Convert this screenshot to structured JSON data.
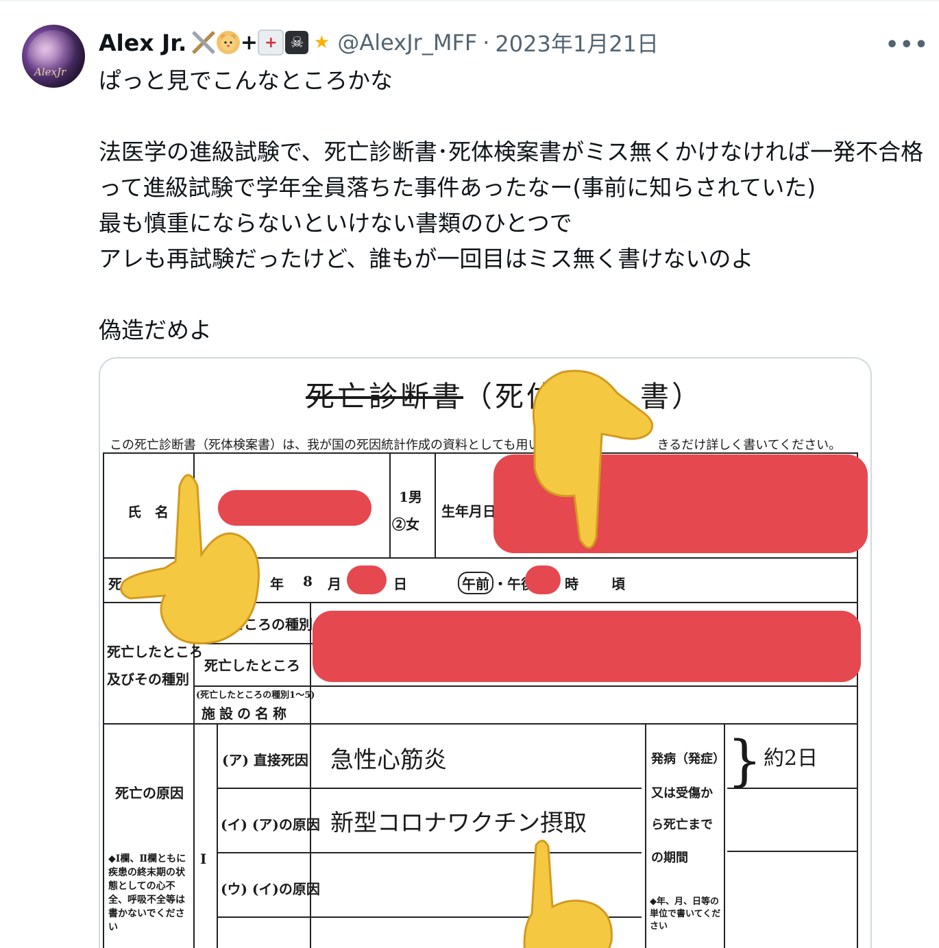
{
  "user": {
    "display_name": "Alex Jr.",
    "handle": "@AlexJr_MFF",
    "date": "2023年1月21日",
    "separator": "·",
    "avatar_signature": "AlexJr",
    "badge_plus": "+"
  },
  "tweet": {
    "text": "ぱっと見でこんなところかな\n\n法医学の進級試験で、死亡診断書･死体検案書がミス無くかけなければ一発不合格って進級試験で学年全員落ちた事件あったなー(事前に知らされていた)\n最も慎重にならないといけない書類のひとつで\nアレも再試験だったけど、誰もが一回目はミス無く書けないのよ\n\n偽造だめよ"
  },
  "menu": {
    "more_label": "•••"
  },
  "document": {
    "title_struck": "死亡診断書",
    "title_rest": "（死体",
    "title_end": "書）",
    "note": "この死亡診断書（死体検案書）は、我が国の死因統計作成の資料としても用い",
    "note_end": "きるだけ詳しく書いてください。",
    "name_label": "氏　名",
    "sex_male": "1男",
    "sex_female": "②女",
    "birth_label": "生年月日",
    "death_prefix": "死",
    "year_label": "年",
    "month_value": "8",
    "month_label": "月",
    "day_label": "日",
    "am_label": "午前",
    "pm_label": "・午後",
    "hour_label": "時",
    "approx_label": "頃",
    "place_kind_label": "ところの種別",
    "place_section_label_1": "死亡したところ",
    "place_section_label_2": "及びその種別",
    "place_label": "死亡したところ",
    "facility_note": "(死亡したところの種別1～5)",
    "facility_label": "施設の名称",
    "cause_section_label": "死亡の原因",
    "cause_roman": "Ⅰ",
    "cause_note": "◆Ⅰ欄、Ⅱ欄ともに疾患の終末期の状態としての心不全、呼吸不全等は書かないでください",
    "row_a_label": "(ア) 直接死因",
    "row_a_value": "急性心筋炎",
    "row_b_label": "(イ) (ア)の原因",
    "row_b_value": "新型コロナワクチン摂取",
    "row_c_label": "(ウ) (イ)の原因",
    "onset_label_1": "発病（発症）",
    "onset_label_2": "又は受傷か",
    "onset_label_3": "ら死亡まで",
    "onset_label_4": "の期間",
    "onset_value": "約2日",
    "onset_note": "◆年、月、日等の単位で書いてください"
  },
  "colors": {
    "redaction": "#e5484f",
    "emoji_hand": "#f5c842",
    "muted": "#536471",
    "border": "#cfd9de"
  },
  "icons": [
    "crossed-swords-icon",
    "hamster-icon",
    "ambulance-icon",
    "pirate-flag-icon",
    "dizzy-star-icon",
    "more-icon",
    "pointing-hand-icon"
  ]
}
